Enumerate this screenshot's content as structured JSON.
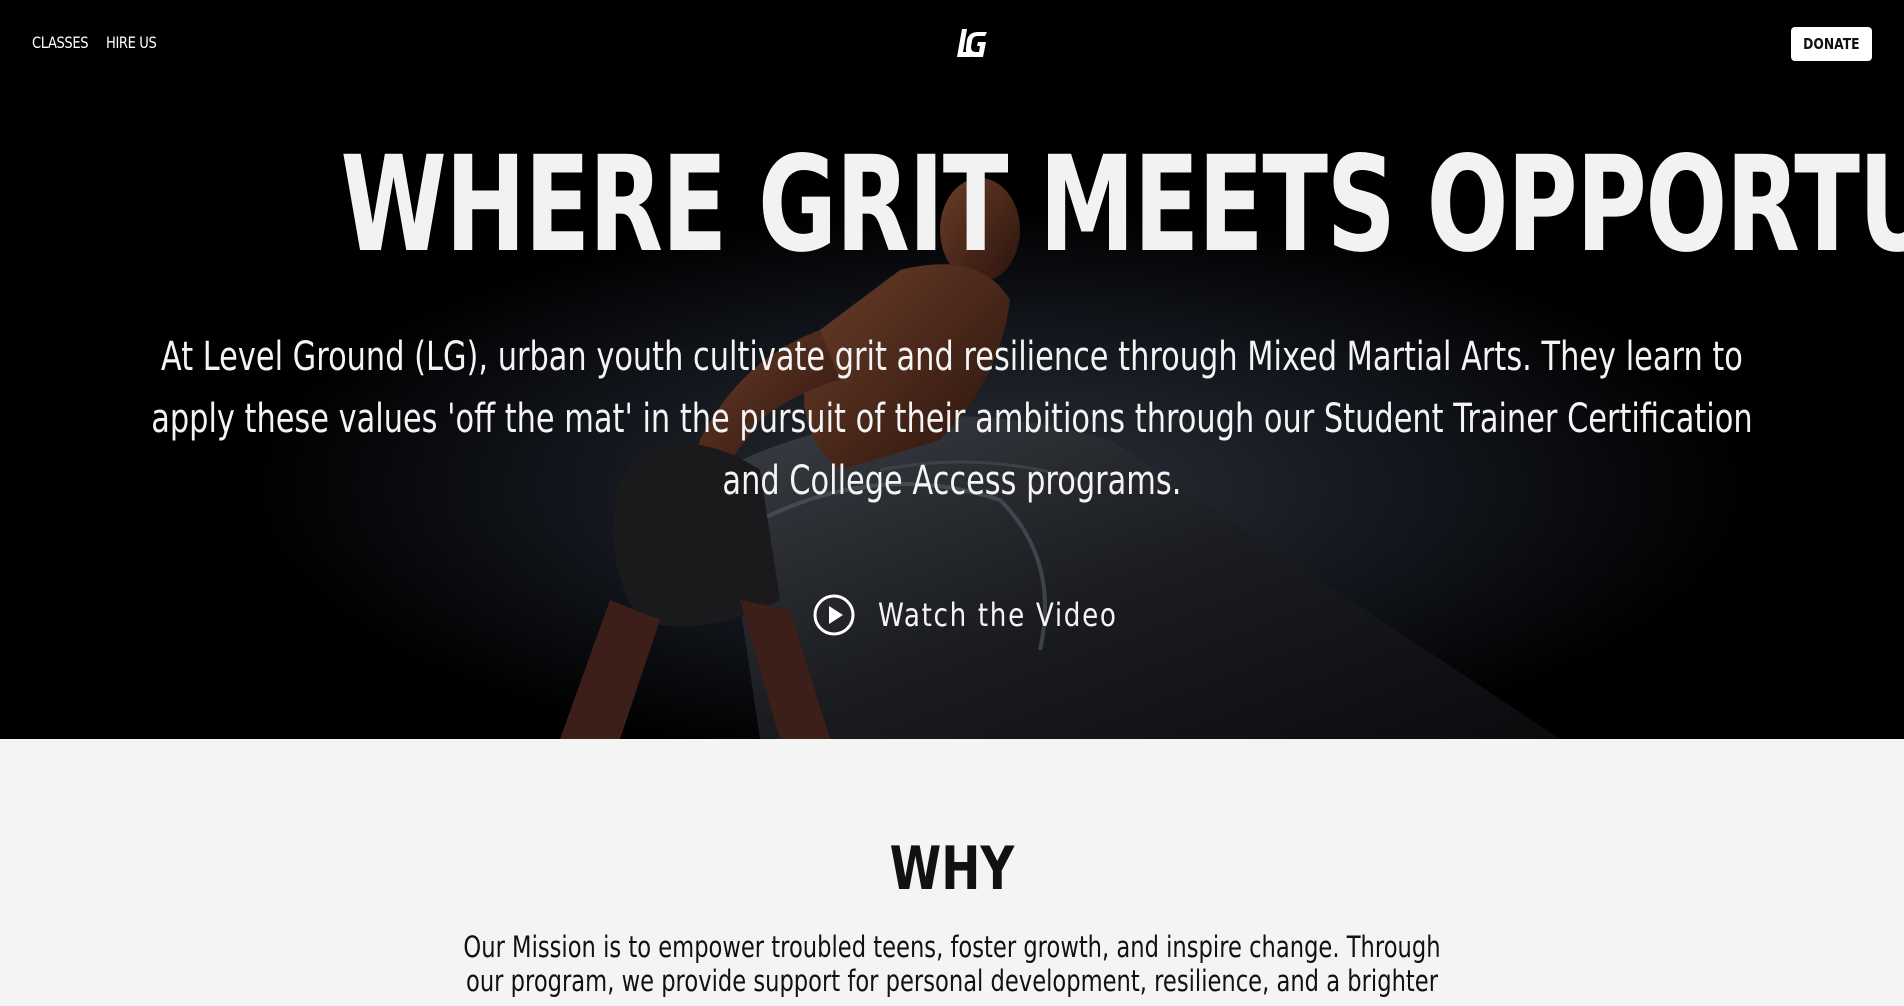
{
  "nav": {
    "links": [
      "CLASSES",
      "HIRE US"
    ],
    "logo_text": "LG",
    "donate_label": "DONATE"
  },
  "hero": {
    "headline": "WHERE GRIT MEETS OPPORTUNITY",
    "intro": "At Level Ground (LG), urban youth cultivate grit and resilience through Mixed Martial Arts. They learn to apply these values 'off the mat' in the pursuit of their ambitions through our Student Trainer Certification and College Access programs.",
    "watch_label": "Watch the Video",
    "watch_icon": "play-circle-icon"
  },
  "why": {
    "title": "WHY",
    "mission": "Our Mission is to empower troubled teens, foster growth, and inspire change. Through our program, we provide support for personal development, resilience, and a brighter"
  },
  "colors": {
    "hero_bg": "#000000",
    "section_bg": "#f4f4f4",
    "text_light": "#f2f2f2",
    "text_dark": "#111111"
  }
}
